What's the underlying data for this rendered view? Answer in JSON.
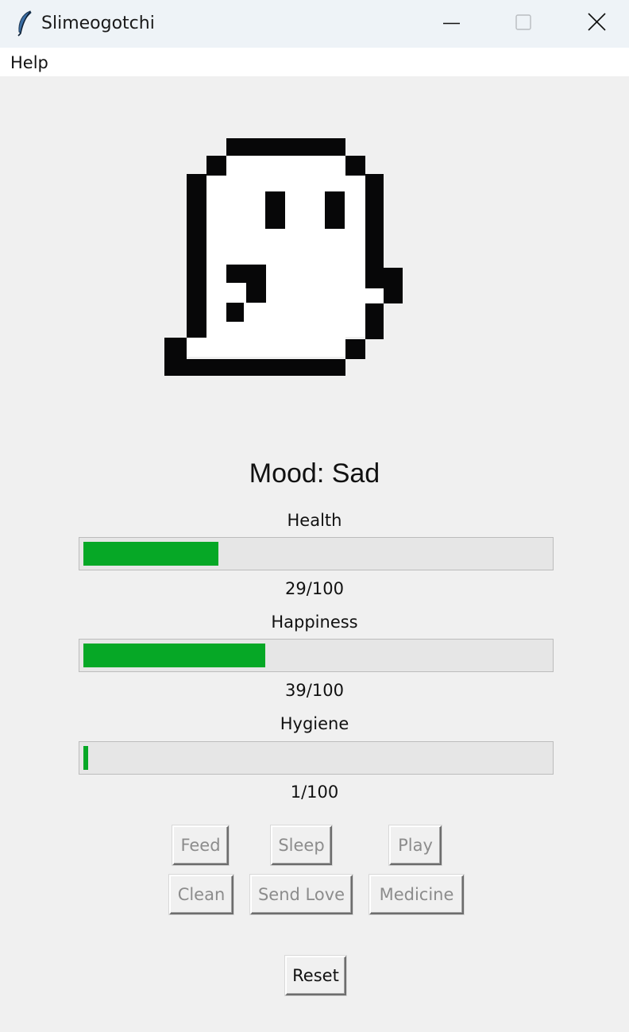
{
  "window": {
    "title": "Slimeogotchi",
    "icon": "feather-icon"
  },
  "menu": {
    "items": [
      "Help"
    ]
  },
  "pet": {
    "sprite": "ghost-pixel-sprite",
    "mood_text": "Mood: Sad"
  },
  "stats": [
    {
      "label": "Health",
      "value": 29,
      "max": 100,
      "display": "29/100"
    },
    {
      "label": "Happiness",
      "value": 39,
      "max": 100,
      "display": "39/100"
    },
    {
      "label": "Hygiene",
      "value": 1,
      "max": 100,
      "display": "1/100"
    }
  ],
  "actions": {
    "feed": "Feed",
    "sleep": "Sleep",
    "play": "Play",
    "clean": "Clean",
    "send_love": "Send Love",
    "medicine": "Medicine",
    "reset": "Reset"
  },
  "colors": {
    "bar_fill": "#06a826",
    "bar_track": "#e6e6e6",
    "disabled_text": "#8c8c8c"
  }
}
